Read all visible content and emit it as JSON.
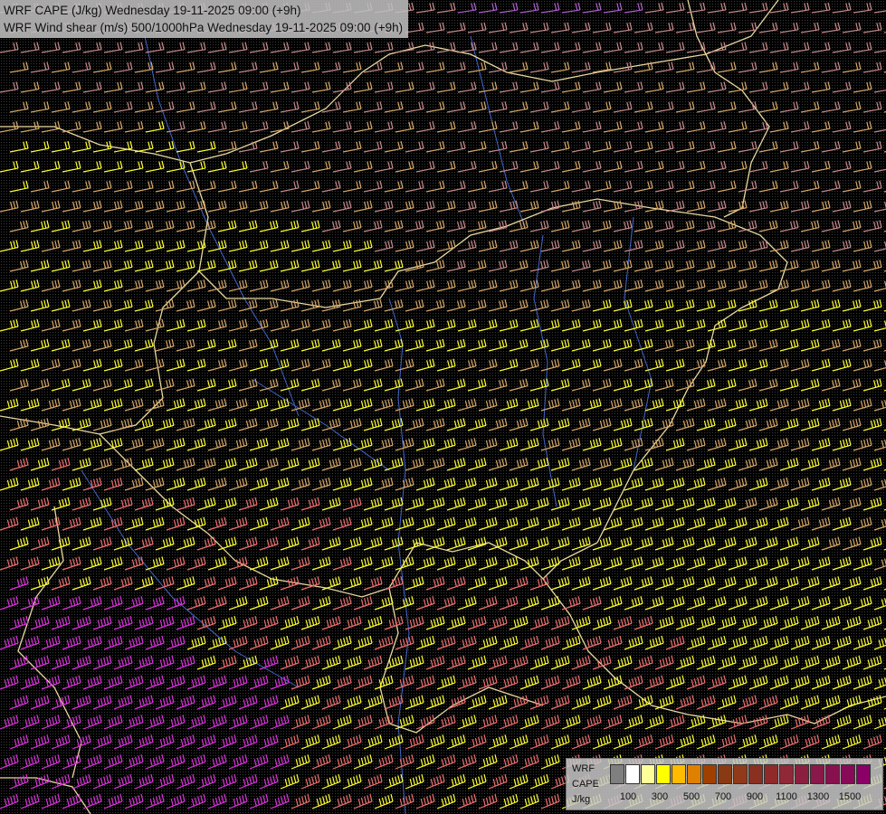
{
  "titles": {
    "line1": "WRF CAPE (J/kg) Wednesday 19-11-2025 09:00 (+9h)",
    "line2": "WRF Wind shear (m/s) 500/1000hPa Wednesday 19-11-2025 09:00 (+9h)"
  },
  "legend": {
    "label_model": "WRF",
    "label_field": "CAPE",
    "label_unit": "J/kg",
    "colors": [
      "#7f7f7f",
      "#ffffff",
      "#ffff99",
      "#ffff00",
      "#ffbb00",
      "#e08000",
      "#a04000",
      "#8a3a12",
      "#903a1a",
      "#8a3020",
      "#902a2a",
      "#902838",
      "#8c1f40",
      "#8a1848",
      "#88104e",
      "#880b58",
      "#8a0066"
    ],
    "tick_labels": [
      "100",
      "300",
      "500",
      "700",
      "900",
      "1100",
      "1300",
      "1500"
    ]
  },
  "barb_colors": {
    "magenta": "#dd33dd",
    "salmon": "#f07070",
    "yellow": "#ffff33",
    "tan": "#d8a868",
    "mauve": "#c88a8a",
    "violet": "#b060d0"
  },
  "map_line_colors": {
    "border": "#e8d8a0",
    "river": "#4466cc"
  }
}
